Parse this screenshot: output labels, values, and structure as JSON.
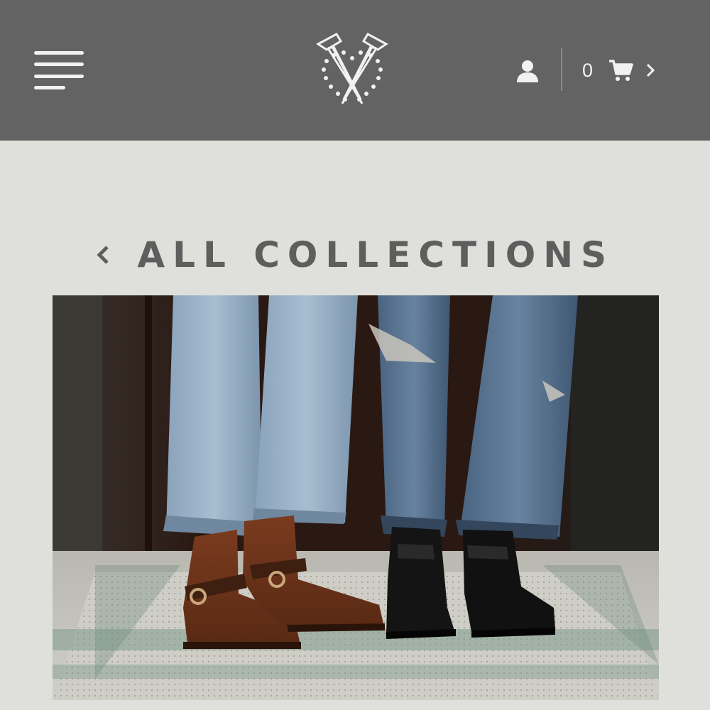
{
  "header": {
    "menu_icon": "hamburger-menu-icon",
    "logo_icon": "crossed-nails-heart-logo",
    "account_icon": "user-icon",
    "cart": {
      "count": "0",
      "icon": "shopping-cart-icon",
      "chevron_icon": "chevron-right-icon"
    }
  },
  "main": {
    "back_link": {
      "chevron_icon": "chevron-left-icon",
      "label": "ALL COLLECTIONS"
    },
    "hero_image": {
      "subject": "two people in blue jeans wearing brown harness boots and black Chelsea boots on a mosaic tile floor"
    }
  },
  "colors": {
    "header_bg": "#636363",
    "page_bg": "#dfe0dc",
    "heading_text": "#5e5e5e",
    "header_icons": "#f1f1f1"
  }
}
